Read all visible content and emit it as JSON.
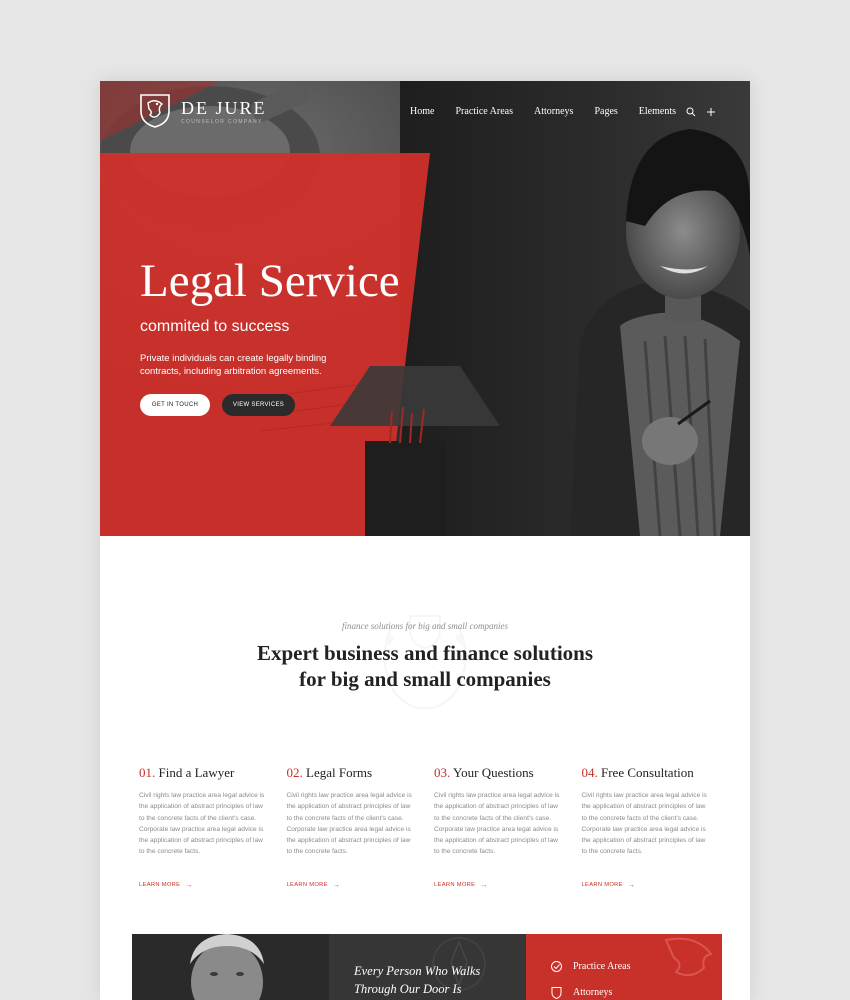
{
  "brand": {
    "name": "DE JURE",
    "tagline": "COUNSELOR COMPANY"
  },
  "nav": {
    "items": [
      "Home",
      "Practice Areas",
      "Attorneys",
      "Pages",
      "Elements"
    ],
    "icons": [
      "search-icon",
      "plus-icon"
    ]
  },
  "hero": {
    "title": "Legal Service",
    "subtitle": "commited to success",
    "description": "Private individuals can create legally binding contracts, including arbitration agreements.",
    "primary_button": "GET IN TOUCH",
    "secondary_button": "VIEW SERVICES"
  },
  "intro": {
    "kicker": "finance solutions for big and small companies",
    "title_line1": "Expert business and finance solutions",
    "title_line2": "for big and small companies"
  },
  "features": [
    {
      "number": "01.",
      "title": "Find a Lawyer",
      "text": "Civil rights law practice area legal advice is the application of abstract principles of law to the concrete facts of the client's case. Corporate law practice area legal advice is the application of abstract principles of law to the concrete facts.",
      "link": "LEARN MORE"
    },
    {
      "number": "02.",
      "title": "Legal Forms",
      "text": "Civil rights law practice area legal advice is the application of abstract principles of law to the concrete facts of the client's case. Corporate law practice area legal advice is the application of abstract principles of law to the concrete facts.",
      "link": "LEARN MORE"
    },
    {
      "number": "03.",
      "title": "Your Questions",
      "text": "Civil rights law practice area legal advice is the application of abstract principles of law to the concrete facts of the client's case. Corporate law practice area legal advice is the application of abstract principles of law to the concrete facts.",
      "link": "LEARN MORE"
    },
    {
      "number": "04.",
      "title": "Free Consultation",
      "text": "Civil rights law practice area legal advice is the application of abstract principles of law to the concrete facts of the client's case. Corporate law practice area legal advice is the application of abstract principles of law to the concrete facts.",
      "link": "LEARN MORE"
    }
  ],
  "band": {
    "quote_line1": "Every Person Who Walks",
    "quote_line2": "Through Our Door Is",
    "links": [
      "Practice Areas",
      "Attorneys"
    ]
  },
  "colors": {
    "accent": "#c8302a",
    "dark": "#2b2b2b",
    "backdrop": "#e6e6e6"
  }
}
